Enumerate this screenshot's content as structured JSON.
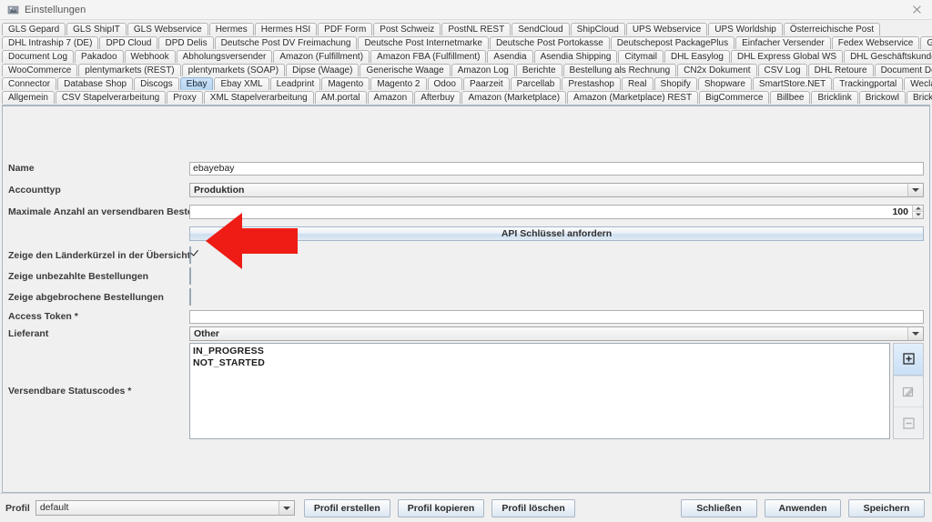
{
  "window": {
    "title": "Einstellungen",
    "icon": "settings-app-icon",
    "close_label": "×"
  },
  "tabs": {
    "active": "Ebay",
    "rows": [
      [
        "GLS Gepard",
        "GLS ShipIT",
        "GLS Webservice",
        "Hermes",
        "Hermes HSI",
        "PDF Form",
        "Post Schweiz",
        "PostNL REST",
        "SendCloud",
        "ShipCloud",
        "UPS Webservice",
        "UPS Worldship",
        "Österreichische Post"
      ],
      [
        "DHL Intraship 7 (DE)",
        "DPD Cloud",
        "DPD Delis",
        "Deutsche Post DV Freimachung",
        "Deutsche Post Internetmarke",
        "Deutsche Post Portokasse",
        "Deutschepost PackagePlus",
        "Einfacher Versender",
        "Fedex Webservice",
        "GEL Express"
      ],
      [
        "Document Log",
        "Pakadoo",
        "Webhook",
        "Abholungsversender",
        "Amazon (Fulfillment)",
        "Amazon FBA (Fulfillment)",
        "Asendia",
        "Asendia Shipping",
        "Citymail",
        "DHL Easylog",
        "DHL Express Global WS",
        "DHL Geschäftskundenversand"
      ],
      [
        "WooCommerce",
        "plentymarkets (REST)",
        "plentymarkets (SOAP)",
        "Dipse (Waage)",
        "Generische Waage",
        "Amazon Log",
        "Berichte",
        "Bestellung als Rechnung",
        "CN2x Dokument",
        "CSV Log",
        "DHL Retoure",
        "Document Downloader"
      ],
      [
        "Connector",
        "Database Shop",
        "Discogs",
        "Ebay",
        "Ebay XML",
        "Leadprint",
        "Magento",
        "Magento 2",
        "Odoo",
        "Paarzeit",
        "Parcellab",
        "Prestashop",
        "Real",
        "Shopify",
        "Shopware",
        "SmartStore.NET",
        "Trackingportal",
        "Weclapp"
      ],
      [
        "Allgemein",
        "CSV Stapelverarbeitung",
        "Proxy",
        "XML Stapelverarbeitung",
        "AM.portal",
        "Amazon",
        "Afterbuy",
        "Amazon (Marketplace)",
        "Amazon (Marketplace) REST",
        "BigCommerce",
        "Billbee",
        "Bricklink",
        "Brickowl",
        "Brickscout"
      ]
    ]
  },
  "form": {
    "name": {
      "label": "Name",
      "value": "ebayebay"
    },
    "accounttyp": {
      "label": "Accounttyp",
      "value": "Produktion"
    },
    "max_orders": {
      "label": "Maximale Anzahl an versendbaren Bestellungen",
      "value": "100"
    },
    "api_button": {
      "label": "API Schlüssel anfordern"
    },
    "show_country": {
      "label": "Zeige den Länderkürzel in der Übersicht",
      "checked": true
    },
    "show_unpaid": {
      "label": "Zeige unbezahlte Bestellungen",
      "checked": false
    },
    "show_cancelled": {
      "label": "Zeige abgebrochene Bestellungen",
      "checked": false
    },
    "access_token": {
      "label": "Access Token *",
      "value": ""
    },
    "lieferant": {
      "label": "Lieferant",
      "value": "Other"
    },
    "statuscodes": {
      "label": "Versendbare Statuscodes *",
      "items": [
        "IN_PROGRESS",
        "NOT_STARTED"
      ],
      "add_icon": "add-box-icon",
      "edit_icon": "edit-pencil-icon",
      "remove_icon": "remove-box-icon"
    }
  },
  "bottom": {
    "profile_label": "Profil",
    "profile_value": "default",
    "create_profile": "Profil erstellen",
    "copy_profile": "Profil kopieren",
    "delete_profile": "Profil löschen",
    "close": "Schließen",
    "apply": "Anwenden",
    "save": "Speichern"
  },
  "annotation": {
    "type": "red-left-arrow",
    "color": "#ee1c14"
  }
}
